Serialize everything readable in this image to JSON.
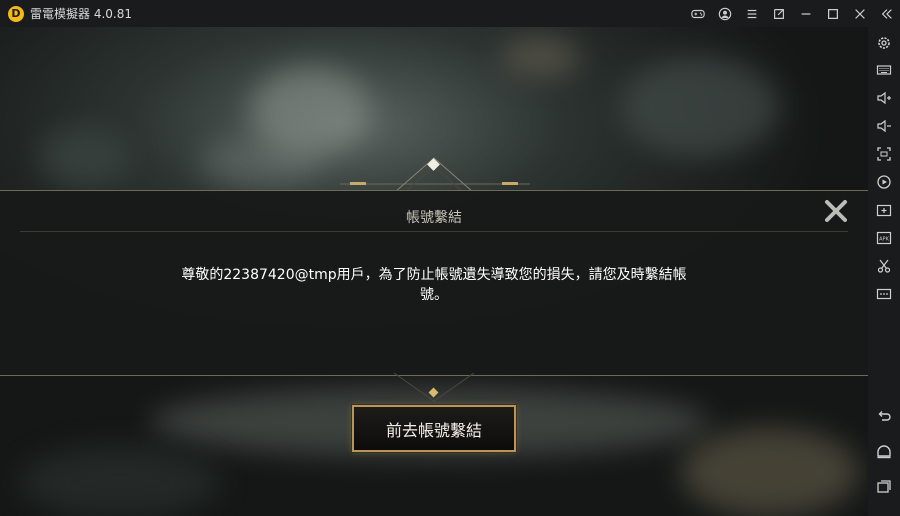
{
  "app": {
    "title": "雷電模擬器 4.0.81",
    "logo_glyph": "D",
    "accent": "#f5b915"
  },
  "titlebar_icons": [
    "gamepad-icon",
    "account-icon",
    "menu-icon",
    "export-icon",
    "minimize-icon",
    "maximize-icon",
    "close-icon",
    "collapse-sidebar-icon"
  ],
  "sidebar_icons": [
    "settings-icon",
    "keyboard-icon",
    "volume-up-icon",
    "volume-down-icon",
    "fullscreen-icon",
    "record-icon",
    "screenshot-icon",
    "apk-icon",
    "scissors-icon",
    "more-icon",
    "back-icon",
    "home-icon",
    "recent-apps-icon"
  ],
  "dialog": {
    "title": "帳號繫結",
    "message": "尊敬的22387420@tmp用戶，為了防止帳號遺失導致您的損失，請您及時繫結帳號。",
    "confirm_label": "前去帳號繫結",
    "border_color": "#b8965a"
  }
}
